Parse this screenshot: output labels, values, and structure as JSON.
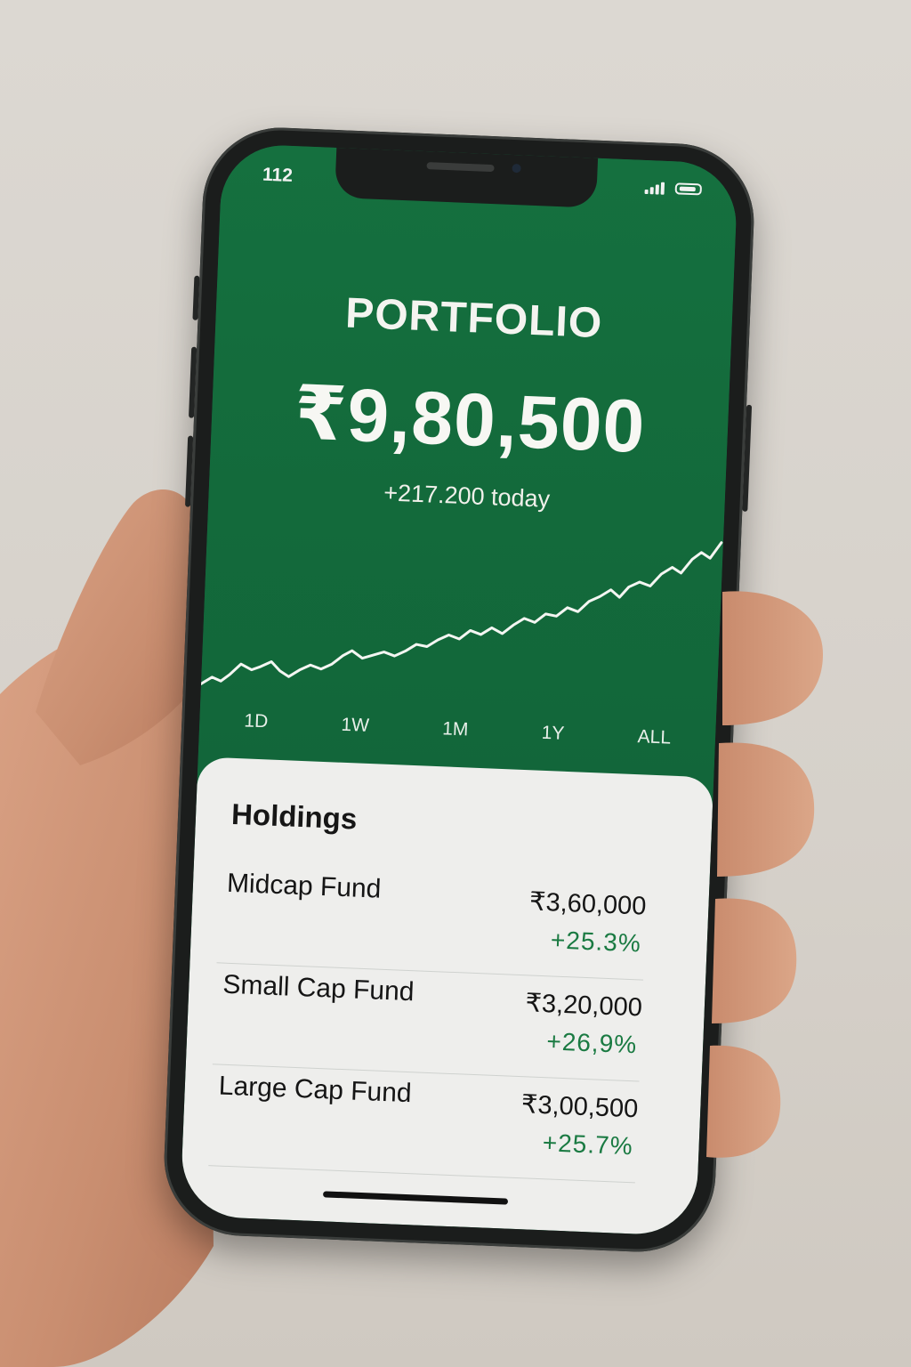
{
  "status_bar": {
    "time": "112"
  },
  "portfolio": {
    "title": "PORTFOLIO",
    "total_value": "₹9,80,500",
    "today_change": "+217.200  today",
    "chart_trend": "rising"
  },
  "time_ranges": [
    "1D",
    "1W",
    "1M",
    "1Y",
    "ALL"
  ],
  "holdings": {
    "title": "Holdings",
    "items": [
      {
        "name": "Midcap Fund",
        "value": "₹3,60,000",
        "change": "+25.3%"
      },
      {
        "name": "Small Cap Fund",
        "value": "₹3,20,000",
        "change": "+26,9%"
      },
      {
        "name": "Large Cap Fund",
        "value": "₹3,00,500",
        "change": "+25.7%"
      }
    ]
  },
  "colors": {
    "brand_green": "#136a3b",
    "positive": "#1a7a42",
    "card_bg": "#eeeeec"
  }
}
